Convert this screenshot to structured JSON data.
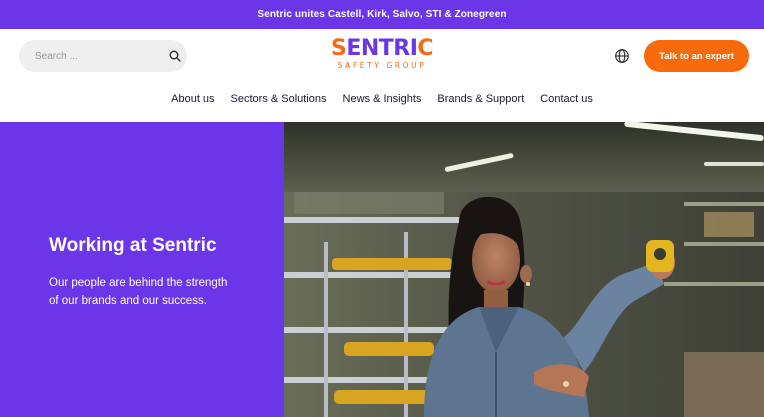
{
  "announcement": {
    "text": "Sentric unites Castell, Kirk, Salvo, STI & Zonegreen"
  },
  "search": {
    "placeholder": "Search ...",
    "icon": "search-icon"
  },
  "logo": {
    "word_s": "S",
    "word_rest": "ENTRI",
    "word_c": "C",
    "subtitle": "SAFETY GROUP"
  },
  "header": {
    "language_icon": "globe-icon",
    "cta_label": "Talk to an expert"
  },
  "nav": {
    "items": [
      {
        "label": "About us"
      },
      {
        "label": "Sectors & Solutions"
      },
      {
        "label": "News & Insights"
      },
      {
        "label": "Brands & Support"
      },
      {
        "label": "Contact us"
      }
    ]
  },
  "hero": {
    "title": "Working at Sentric",
    "description": "Our people are behind the strength of our brands and our success."
  },
  "colors": {
    "brand_purple": "#6b35e8",
    "brand_orange": "#f76b0c"
  }
}
